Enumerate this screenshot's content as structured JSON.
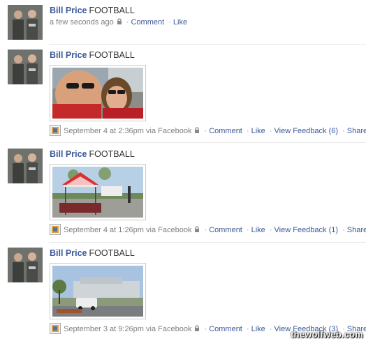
{
  "posts": [
    {
      "author": "Bill Price",
      "message": "FOOTBALL",
      "timestamp": "a few seconds ago",
      "actions": {
        "comment": "Comment",
        "like": "Like"
      }
    },
    {
      "author": "Bill Price",
      "message": "FOOTBALL",
      "timestamp": "September 4 at 2:36pm via Facebook",
      "actions": {
        "comment": "Comment",
        "like": "Like",
        "feedback": "View Feedback (6)",
        "share": "Share"
      }
    },
    {
      "author": "Bill Price",
      "message": "FOOTBALL",
      "timestamp": "September 4 at 1:26pm via Facebook",
      "actions": {
        "comment": "Comment",
        "like": "Like",
        "feedback": "View Feedback (1)",
        "share": "Share"
      }
    },
    {
      "author": "Bill Price",
      "message": "FOOTBALL",
      "timestamp": "September 3 at 9:26pm via Facebook",
      "actions": {
        "comment": "Comment",
        "like": "Like",
        "feedback": "View Feedback (3)",
        "share": "Share"
      }
    }
  ],
  "separator": "·",
  "watermark": "thewolfweb.com",
  "colors": {
    "link": "#3b5998",
    "meta": "#808080",
    "divider": "#e9e9e9"
  }
}
